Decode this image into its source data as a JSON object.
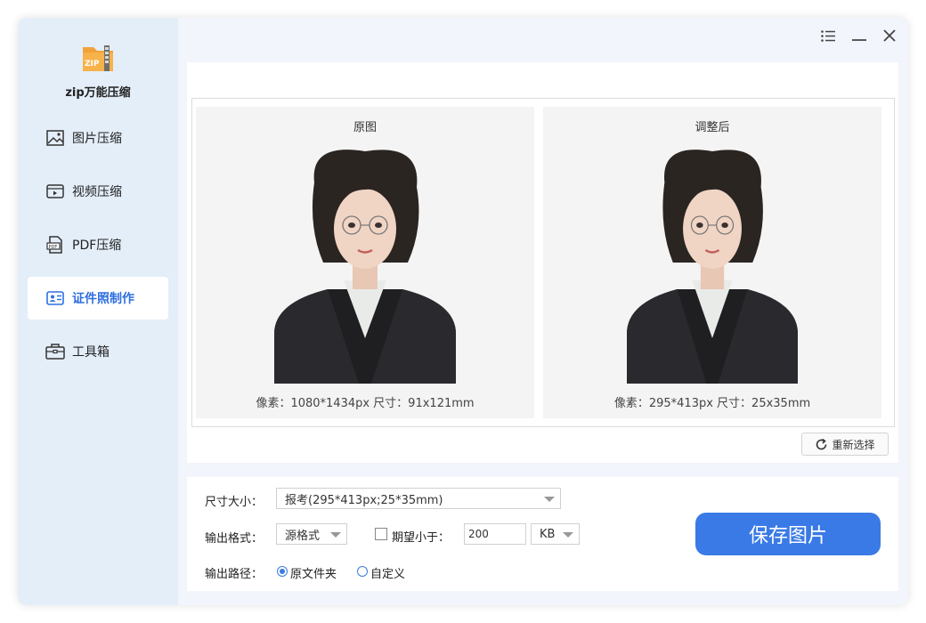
{
  "app": {
    "title": "zip万能压缩",
    "logo_text": "ZIP"
  },
  "sidebar": {
    "items": [
      {
        "label": "图片压缩",
        "icon": "image-icon"
      },
      {
        "label": "视频压缩",
        "icon": "video-icon"
      },
      {
        "label": "PDF压缩",
        "icon": "pdf-icon"
      },
      {
        "label": "证件照制作",
        "icon": "id-photo-icon",
        "active": true
      },
      {
        "label": "工具箱",
        "icon": "toolbox-icon"
      }
    ]
  },
  "compare": {
    "original": {
      "title": "原图",
      "info": "像素：1080*1434px  尺寸：91x121mm"
    },
    "adjusted": {
      "title": "调整后",
      "info": "像素：295*413px  尺寸：25x35mm"
    },
    "reselect_label": "重新选择"
  },
  "settings": {
    "size_label": "尺寸大小：",
    "size_value": "报考(295*413px;25*35mm)",
    "format_label": "输出格式：",
    "format_value": "源格式",
    "expect_label": "期望小于：",
    "expect_value": "200",
    "unit_value": "KB",
    "path_label": "输出路径：",
    "path_options": [
      "原文件夹",
      "自定义"
    ],
    "path_selected": "原文件夹",
    "save_label": "保存图片"
  },
  "colors": {
    "accent": "#3a7ae6",
    "sidebar_bg": "#e4eef9"
  }
}
